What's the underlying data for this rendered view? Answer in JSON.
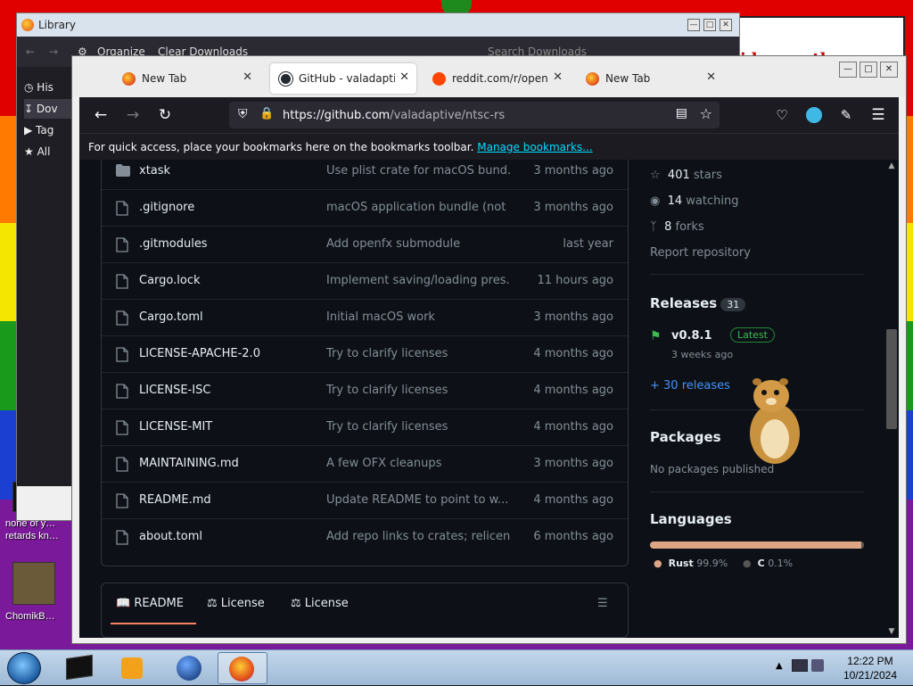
{
  "library": {
    "title": "Library",
    "toolbar": {
      "organize": "Organize",
      "clear": "Clear Downloads",
      "search_placeholder": "Search Downloads"
    },
    "sidebar": [
      "His",
      "Dov",
      "Tag",
      "All"
    ]
  },
  "wallpaper": {
    "banner_text": "ide month"
  },
  "desktop": {
    "icon1_label": "none of y… retards kn…",
    "icon2_label": "ChomikB…"
  },
  "browser": {
    "tabs": [
      {
        "label": "New Tab",
        "icon": "firefox-icon",
        "active": false
      },
      {
        "label": "GitHub - valadaptive/ntsc-rs",
        "icon": "github-icon",
        "active": true
      },
      {
        "label": "reddit.com/r/opensource",
        "icon": "reddit-icon",
        "active": false
      },
      {
        "label": "New Tab",
        "icon": "firefox-icon",
        "active": false
      }
    ],
    "url_host": "https://github.com",
    "url_path": "/valadaptive/ntsc-rs",
    "bookmarks_text": "For quick access, place your bookmarks here on the bookmarks toolbar.",
    "bookmarks_link": "Manage bookmarks..."
  },
  "files": [
    {
      "name": "xtask",
      "type": "folder",
      "message": "Use plist crate for macOS bund...",
      "date": "3 months ago"
    },
    {
      "name": ".gitignore",
      "type": "file",
      "message": "macOS application bundle (not ...",
      "date": "3 months ago"
    },
    {
      "name": ".gitmodules",
      "type": "file",
      "message": "Add openfx submodule",
      "date": "last year"
    },
    {
      "name": "Cargo.lock",
      "type": "file",
      "message": "Implement saving/loading pres...",
      "date": "11 hours ago"
    },
    {
      "name": "Cargo.toml",
      "type": "file",
      "message": "Initial macOS work",
      "date": "3 months ago"
    },
    {
      "name": "LICENSE-APACHE-2.0",
      "type": "file",
      "message": "Try to clarify licenses",
      "date": "4 months ago"
    },
    {
      "name": "LICENSE-ISC",
      "type": "file",
      "message": "Try to clarify licenses",
      "date": "4 months ago"
    },
    {
      "name": "LICENSE-MIT",
      "type": "file",
      "message": "Try to clarify licenses",
      "date": "4 months ago"
    },
    {
      "name": "MAINTAINING.md",
      "type": "file",
      "message": "A few OFX cleanups",
      "date": "3 months ago"
    },
    {
      "name": "README.md",
      "type": "file",
      "message": "Update README to point to w...",
      "date": "4 months ago"
    },
    {
      "name": "about.toml",
      "type": "file",
      "message": "Add repo links to crates; relicen...",
      "date": "6 months ago"
    }
  ],
  "readme_tabs": [
    "README",
    "License",
    "License"
  ],
  "sidebar": {
    "stars_count": "401",
    "stars_label": "stars",
    "watching_count": "14",
    "watching_label": "watching",
    "forks_count": "8",
    "forks_label": "forks",
    "report": "Report repository",
    "releases_title": "Releases",
    "releases_count": "31",
    "release_tag": "v0.8.1",
    "release_badge": "Latest",
    "release_when": "3 weeks ago",
    "more_releases": "+ 30 releases",
    "packages_title": "Packages",
    "packages_text": "No packages published",
    "languages_title": "Languages",
    "languages": [
      {
        "name": "Rust",
        "percent": "99.9%",
        "color": "#dea584",
        "share": 99.9
      },
      {
        "name": "C",
        "percent": "0.1%",
        "color": "#555555",
        "share": 0.1
      }
    ]
  },
  "taskbar": {
    "time": "12:22 PM",
    "date": "10/21/2024"
  }
}
